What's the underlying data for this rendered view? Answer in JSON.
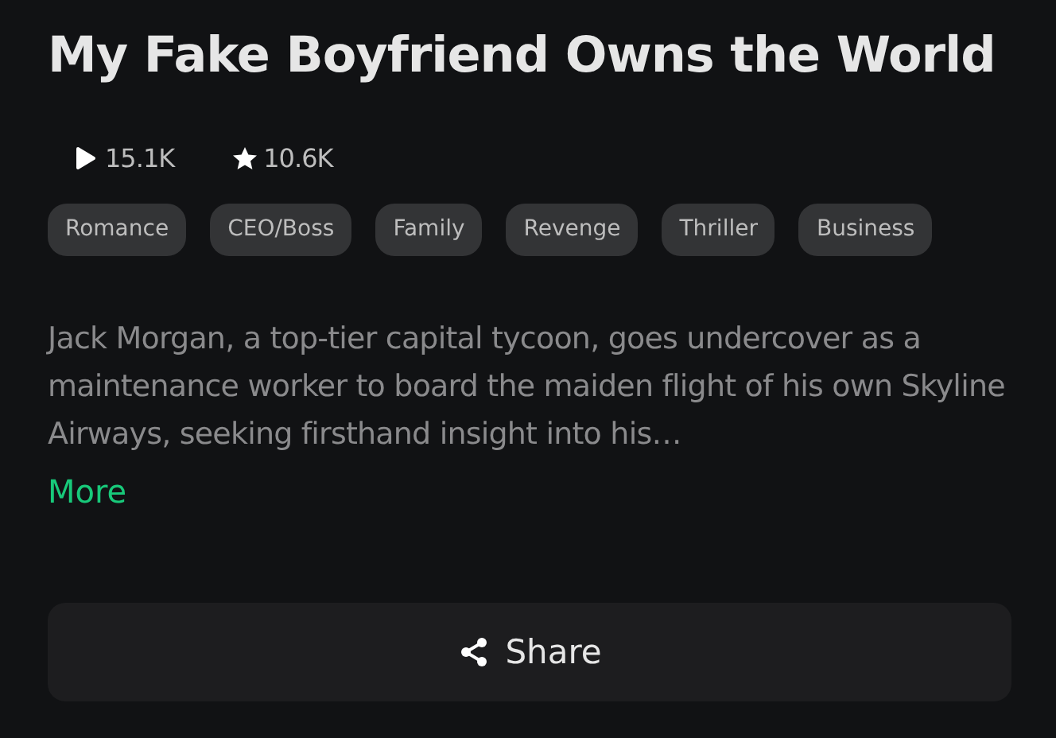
{
  "title": "My Fake Boyfriend Owns the World",
  "stats": [
    {
      "kind": "plays",
      "value": "15.1K"
    },
    {
      "kind": "rating",
      "value": "10.6K"
    }
  ],
  "tags": [
    "Romance",
    "CEO/Boss",
    "Family",
    "Revenge",
    "Thriller",
    "Business"
  ],
  "description": "Jack Morgan, a top-tier capital tycoon, goes undercover as a maintenance worker to board the maiden flight of his own Skyline Airways, seeking firsthand insight into his…",
  "more_link": "More",
  "share_button": "Share"
}
